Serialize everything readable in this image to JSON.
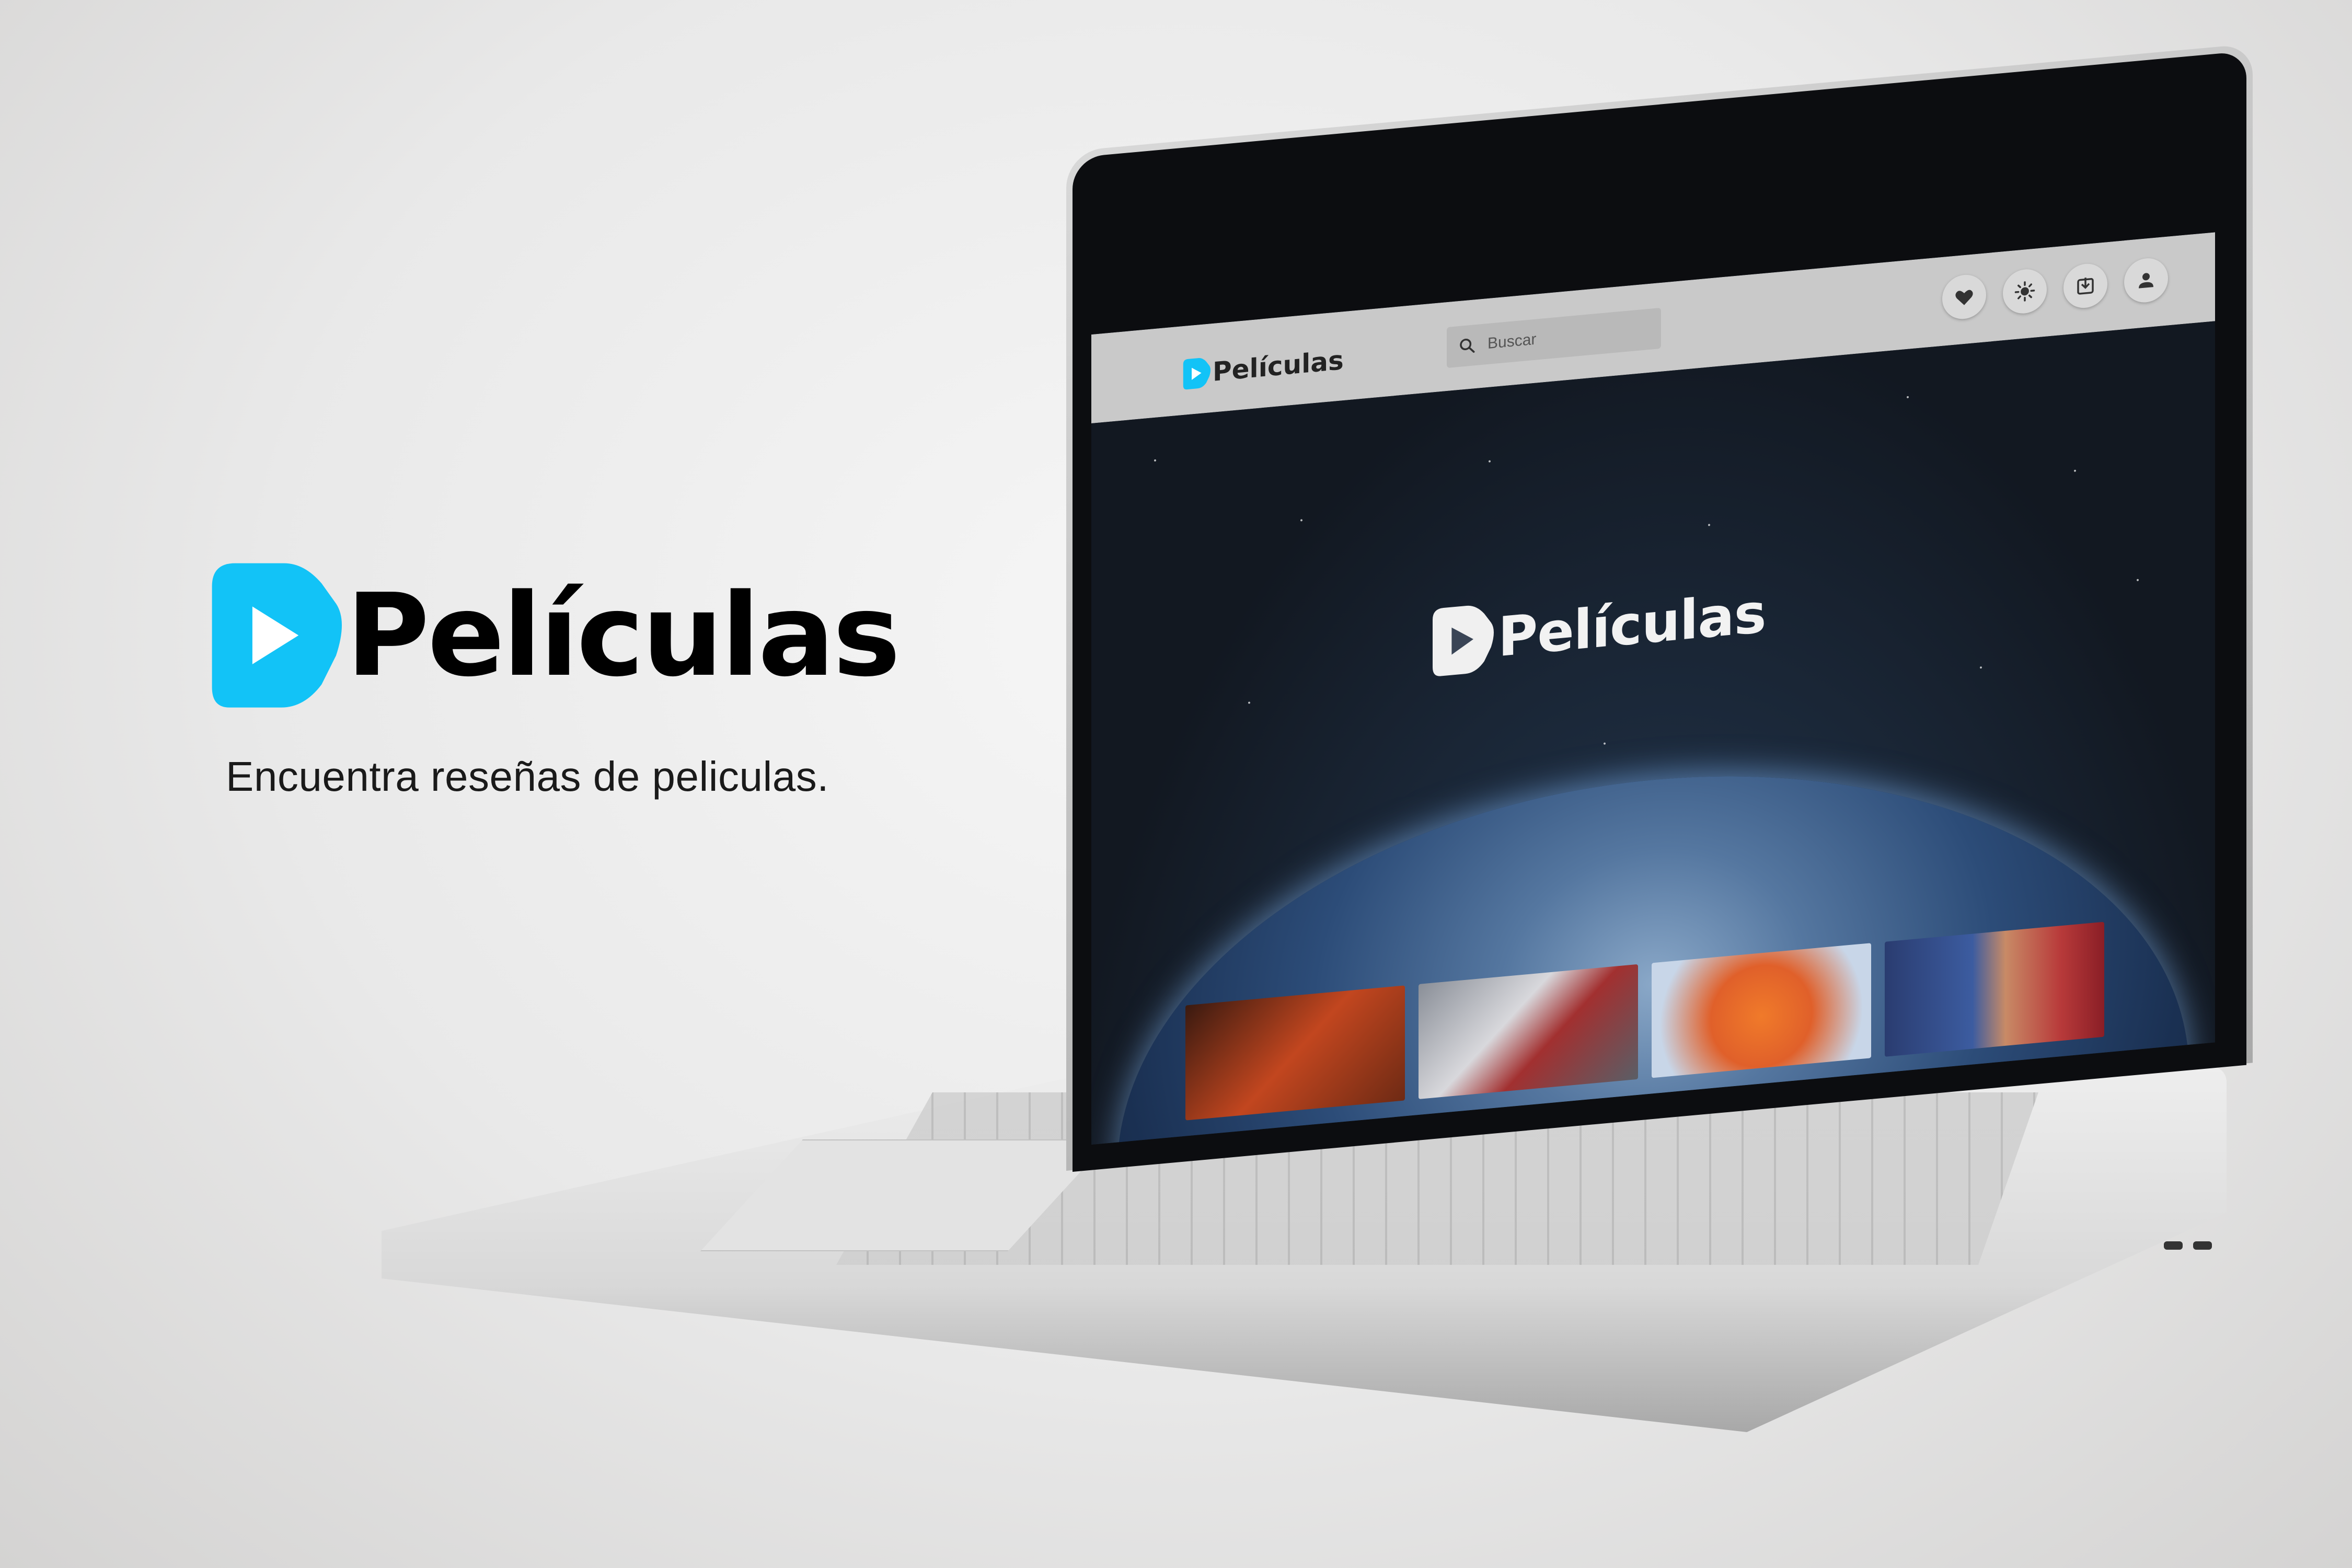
{
  "brand": {
    "name": "Películas",
    "tagline": "Encuentra reseñas de peliculas.",
    "accent_color": "#12c3f7"
  },
  "app": {
    "logo_text": "Películas",
    "search": {
      "placeholder": "Buscar"
    },
    "header_icons": [
      "heart-icon",
      "brightness-icon",
      "download-icon",
      "user-icon"
    ],
    "hero": {
      "logo_text": "Películas"
    },
    "posters": [
      "poster-1",
      "poster-2",
      "poster-3",
      "poster-4"
    ]
  }
}
